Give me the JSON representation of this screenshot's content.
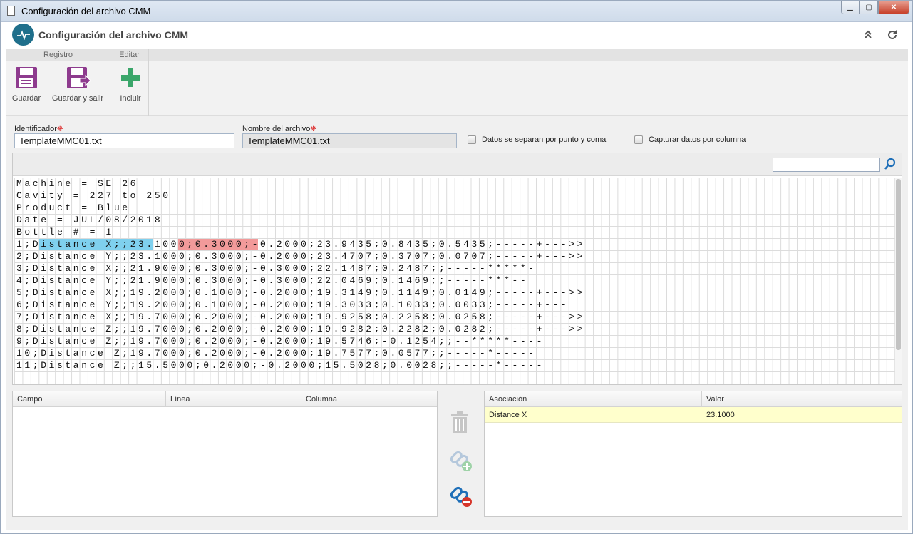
{
  "window": {
    "title": "Configuración del archivo CMM"
  },
  "app": {
    "title": "Configuración del archivo CMM",
    "collapse_icon": "collapse-icon",
    "refresh_icon": "refresh-icon"
  },
  "ribbon": {
    "groups": [
      {
        "label": "Registro"
      },
      {
        "label": "Editar"
      }
    ],
    "buttons": {
      "save": "Guardar",
      "save_exit": "Guardar y salir",
      "include": "Incluir"
    }
  },
  "form": {
    "identifier_label": "Identificador",
    "identifier_value": "TemplateMMC01.txt",
    "filename_label": "Nombre del archivo",
    "filename_value": "TemplateMMC01.txt",
    "chk_semicolon": "Datos se separan por punto y coma",
    "chk_column": "Capturar datos por columna"
  },
  "grid": {
    "search_placeholder": "",
    "rows": [
      "Machine = SE 26",
      "Cavity = 227 to 250",
      "Product = Blue",
      "Date = JUL/08/2018",
      "Bottle # = 1",
      "1;Distance X;;23.1000;0.3000;-0.2000;23.9435;0.8435;0.5435;-----+--->>",
      "2;Distance Y;;23.1000;0.3000;-0.2000;23.4707;0.3707;0.0707;-----+--->>",
      "3;Distance X;;21.9000;0.3000;-0.3000;22.1487;0.2487;;-----*****-",
      "4;Distance Y;;21.9000;0.3000;-0.3000;22.0469;0.1469;;-----***--",
      "5;Distance X;;19.2000;0.1000;-0.2000;19.3149;0.1149;0.0149;-----+--->>",
      "6;Distance Y;;19.2000;0.1000;-0.2000;19.3033;0.1033;0.0033;-----+---",
      "7;Distance X;;19.7000;0.2000;-0.2000;19.9258;0.2258;0.0258;-----+--->>",
      "8;Distance Z;;19.7000;0.2000;-0.2000;19.9282;0.2282;0.0282;-----+--->>",
      "9;Distance Z;;19.7000;0.2000;-0.2000;19.5746;-0.1254;;--*****----",
      "10;Distance Z;19.7000;0.2000;-0.2000;19.7577;0.0577;;-----*-----",
      "11;Distance Z;;15.5000;0.2000;-0.2000;15.5028;0.0028;;-----*-----"
    ]
  },
  "fields_table": {
    "headers": [
      "Campo",
      "Línea",
      "Columna"
    ]
  },
  "assoc_table": {
    "headers": [
      "Asociación",
      "Valor"
    ],
    "rows": [
      {
        "assoc": "Distance X",
        "value": "23.1000"
      }
    ]
  }
}
